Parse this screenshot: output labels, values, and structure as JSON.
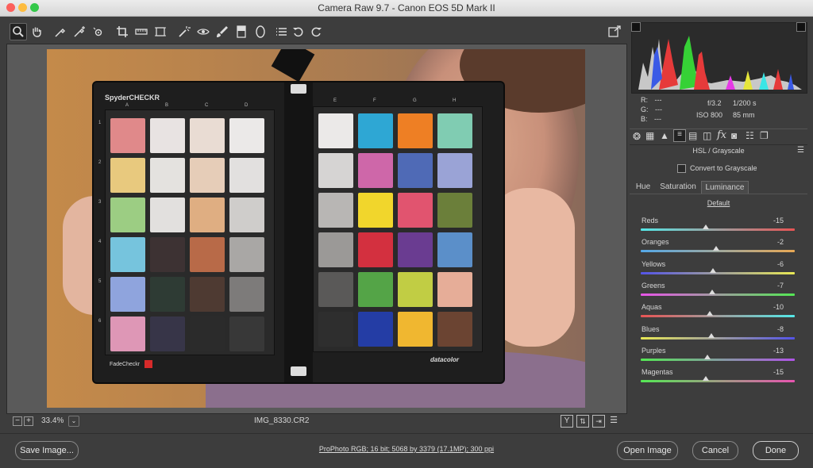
{
  "window": {
    "title": "Camera Raw 9.7  -  Canon EOS 5D Mark II"
  },
  "chart_card": {
    "brand": "SpyderCHECKR",
    "left_cols": [
      "A",
      "B",
      "C",
      "D"
    ],
    "right_cols": [
      "E",
      "F",
      "G",
      "H"
    ],
    "rows": [
      "1",
      "2",
      "3",
      "4",
      "5",
      "6"
    ],
    "fade_label": "FadeCheckr",
    "maker": "datacolor"
  },
  "status": {
    "zoom": "33.4%",
    "filename": "IMG_8330.CR2"
  },
  "info": {
    "r_label": "R:",
    "r_val": "---",
    "g_label": "G:",
    "g_val": "---",
    "b_label": "B:",
    "b_val": "---",
    "aperture": "f/3.2",
    "shutter": "1/200 s",
    "iso": "ISO 800",
    "focal": "85 mm"
  },
  "panel": {
    "title": "HSL / Grayscale",
    "convert_label": "Convert to Grayscale",
    "tabs": [
      "Hue",
      "Saturation",
      "Luminance"
    ],
    "active_tab": "Luminance",
    "default_label": "Default"
  },
  "sliders": [
    {
      "label": "Reds",
      "value": "-15",
      "num": -15,
      "colors": [
        "#54e8e8",
        "#e85454"
      ]
    },
    {
      "label": "Oranges",
      "value": "-2",
      "num": -2,
      "colors": [
        "#54a8e8",
        "#e8a854"
      ]
    },
    {
      "label": "Yellows",
      "value": "-6",
      "num": -6,
      "colors": [
        "#5454e8",
        "#e8e854"
      ]
    },
    {
      "label": "Greens",
      "value": "-7",
      "num": -7,
      "colors": [
        "#e854e8",
        "#54e854"
      ]
    },
    {
      "label": "Aquas",
      "value": "-10",
      "num": -10,
      "colors": [
        "#e85454",
        "#54e8e8"
      ]
    },
    {
      "label": "Blues",
      "value": "-8",
      "num": -8,
      "colors": [
        "#e8e854",
        "#5454e8"
      ]
    },
    {
      "label": "Purples",
      "value": "-13",
      "num": -13,
      "colors": [
        "#54e854",
        "#b054e8"
      ]
    },
    {
      "label": "Magentas",
      "value": "-15",
      "num": -15,
      "colors": [
        "#54e854",
        "#e854b0"
      ]
    }
  ],
  "footer": {
    "save": "Save Image...",
    "workflow": "ProPhoto RGB; 16 bit; 5068 by 3379 (17.1MP); 300 ppi",
    "open": "Open Image",
    "cancel": "Cancel",
    "done": "Done"
  },
  "patches_left": [
    [
      "#e0898a",
      "#e8e3e2",
      "#e9dcd3",
      "#ebe9e8"
    ],
    [
      "#e8c97e",
      "#e4e2df",
      "#e6cdb8",
      "#e2e0df"
    ],
    [
      "#9ccd83",
      "#e2e0de",
      "#dfae82",
      "#cfcdcb"
    ],
    [
      "#76c4dd",
      "#3d3233",
      "#b86a48",
      "#a9a7a5"
    ],
    [
      "#8fa4dd",
      "#2e3b34",
      "#4e3a32",
      "#7d7b7a"
    ],
    [
      "#de97b6",
      "#373548",
      "#2b2b2b",
      "#383838"
    ]
  ],
  "patches_right": [
    [
      "#ebe9e8",
      "#2ea7d4",
      "#ee7f24",
      "#80ccb2"
    ],
    [
      "#d6d4d3",
      "#ce67a9",
      "#4f6ab6",
      "#9aa3d6"
    ],
    [
      "#b8b6b4",
      "#f1d62c",
      "#e1546f",
      "#6b7f3a"
    ],
    [
      "#9b9997",
      "#d3303f",
      "#6a3c91",
      "#5b8fc9"
    ],
    [
      "#5a5958",
      "#54a447",
      "#c1cd44",
      "#e6ad98"
    ],
    [
      "#2e2e2e",
      "#243da5",
      "#f0b730",
      "#6b4432"
    ]
  ]
}
